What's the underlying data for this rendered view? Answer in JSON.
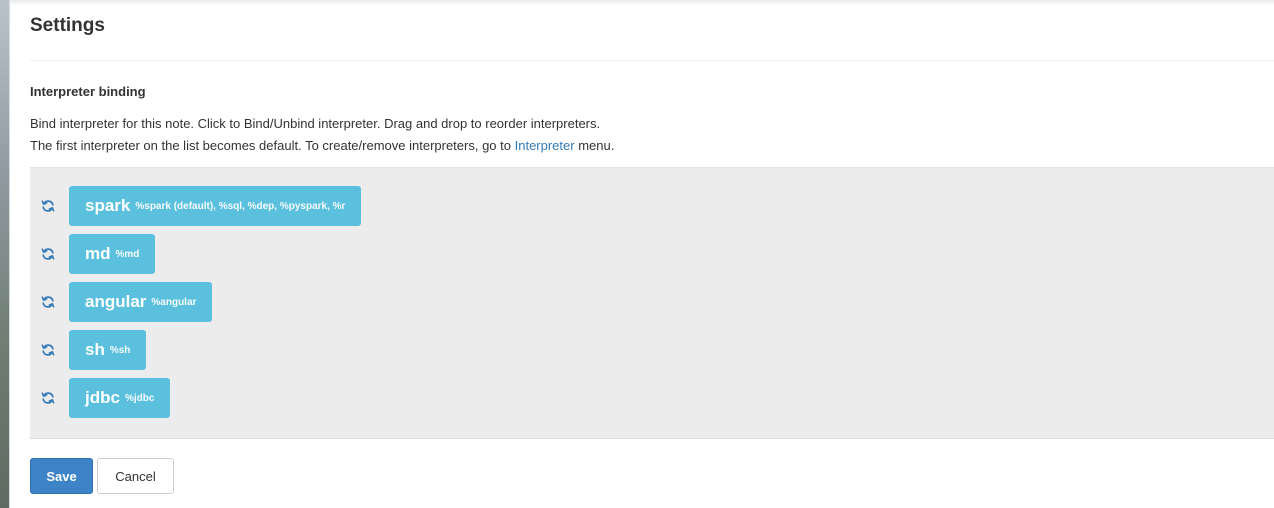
{
  "settings": {
    "title": "Settings"
  },
  "interpreter_binding": {
    "heading": "Interpreter binding",
    "description_line1": "Bind interpreter for this note. Click to Bind/Unbind interpreter. Drag and drop to reorder interpreters.",
    "description_line2_prefix": "The first interpreter on the list becomes default. To create/remove interpreters, go to ",
    "description_line2_link": "Interpreter",
    "description_line2_suffix": " menu.",
    "interpreters": [
      {
        "name": "spark",
        "aliases": "%spark (default), %sql, %dep, %pyspark, %r",
        "icon": "refresh-icon"
      },
      {
        "name": "md",
        "aliases": "%md",
        "icon": "refresh-icon"
      },
      {
        "name": "angular",
        "aliases": "%angular",
        "icon": "refresh-icon"
      },
      {
        "name": "sh",
        "aliases": "%sh",
        "icon": "refresh-icon"
      },
      {
        "name": "jdbc",
        "aliases": "%jdbc",
        "icon": "refresh-icon"
      }
    ]
  },
  "actions": {
    "save_label": "Save",
    "cancel_label": "Cancel"
  },
  "colors": {
    "chip_background": "#5bc0de",
    "primary_button": "#3d83c7",
    "link": "#337ab7",
    "panel_background": "#ececec"
  }
}
